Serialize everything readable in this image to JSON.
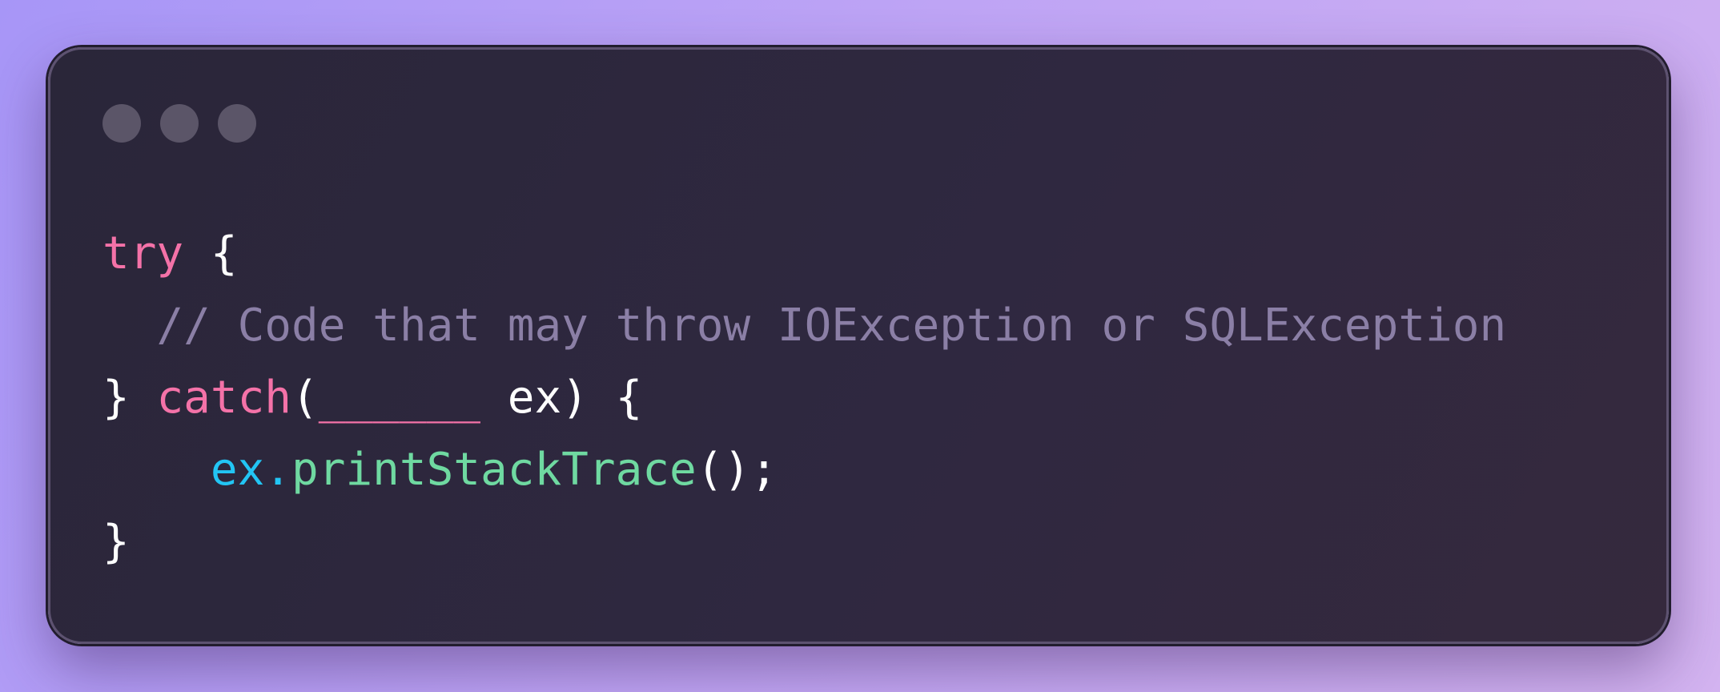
{
  "colors": {
    "keyword": "#f472a8",
    "comment": "#8b7fa6",
    "plain": "#ffffff",
    "variable": "#22c5f4",
    "method": "#6fd9a1",
    "dot": "#5b5568"
  },
  "window": {
    "controls": [
      "window-dot",
      "window-dot",
      "window-dot"
    ]
  },
  "code": {
    "lines": [
      {
        "indent": "",
        "tokens": [
          {
            "text": "try",
            "type": "keyword"
          },
          {
            "text": " {",
            "type": "plain"
          }
        ]
      },
      {
        "indent": "  ",
        "tokens": [
          {
            "text": "// Code that may throw IOException or SQLException",
            "type": "comment"
          }
        ]
      },
      {
        "indent": "",
        "tokens": [
          {
            "text": "} ",
            "type": "plain"
          },
          {
            "text": "catch",
            "type": "keyword"
          },
          {
            "text": "(",
            "type": "plain"
          },
          {
            "text": "______",
            "type": "keyword"
          },
          {
            "text": " ex) {",
            "type": "plain"
          }
        ]
      },
      {
        "indent": "    ",
        "tokens": [
          {
            "text": "ex",
            "type": "variable"
          },
          {
            "text": ".",
            "type": "variable"
          },
          {
            "text": "printStackTrace",
            "type": "method"
          },
          {
            "text": "();",
            "type": "plain"
          }
        ]
      },
      {
        "indent": "",
        "tokens": [
          {
            "text": "}",
            "type": "plain"
          }
        ]
      }
    ]
  }
}
